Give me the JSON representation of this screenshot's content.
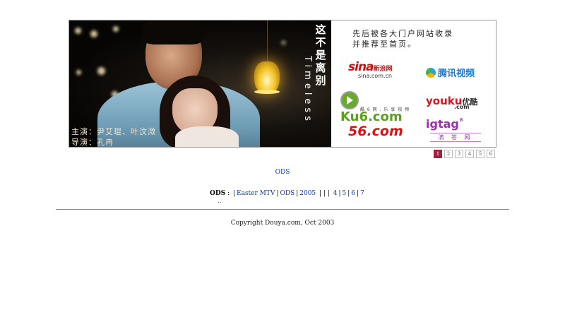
{
  "banner": {
    "title_cn": "这不是离别",
    "title_en": "Timeless",
    "credit_line1": "主演：尹艾琨、叶汶溦",
    "credit_line2": "导演：孔冉",
    "desc_line1": "先后被各大门户网站收录",
    "desc_line2": "并推荐至首页。",
    "logos": {
      "sina_big": "sina",
      "sina_cn": "新浪网",
      "sina_domain": "sina.com.cn",
      "qq": "腾讯视频",
      "ku6": "Ku6.com",
      "ku6_sub": "酷 6 网 . 乐 享 视 频",
      "youku": "youku",
      "youku_cn": "优酷",
      "youku_domain": ".com",
      "fiftysix": "56.com",
      "igtag": "igtag",
      "igtag_reg": "®",
      "igtag_cn": "滴 答 网"
    }
  },
  "pager": [
    "1",
    "2",
    "3",
    "4",
    "5",
    "6"
  ],
  "pager_active": "1",
  "ods_link": "ODS",
  "nav": {
    "label": "ODS",
    "colon": ":",
    "links": [
      "Easter MTV",
      "ODS",
      "2005",
      "4",
      "5",
      "6",
      "7"
    ],
    "pipes_mid": "| | |"
  },
  "tiny": ".. ",
  "copyright": "Copyright Douya.com, Oct 2003"
}
